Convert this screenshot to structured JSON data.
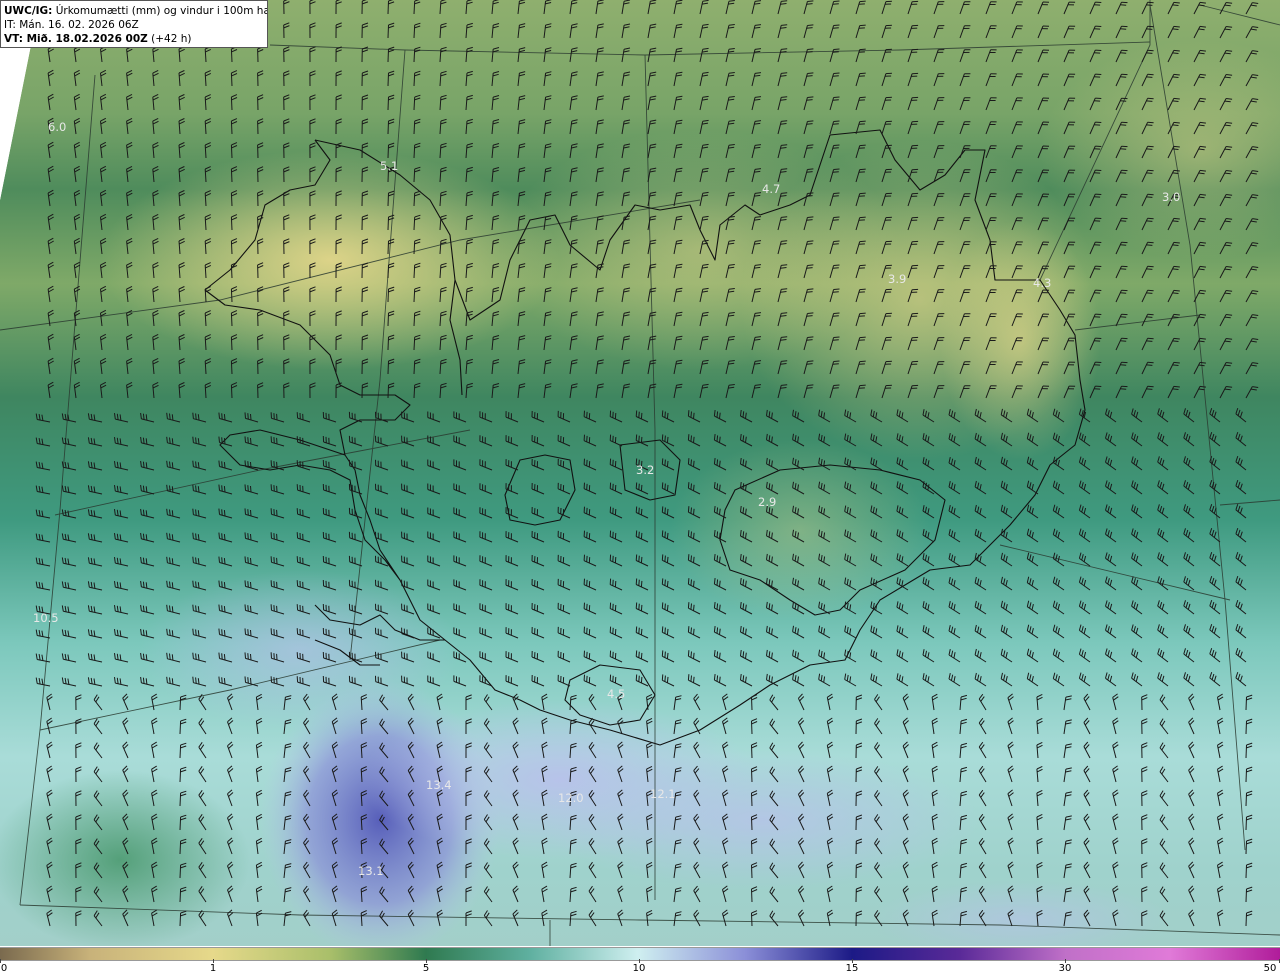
{
  "header": {
    "model_prefix": "UWC/IG:",
    "title": "Úrkomumætti (mm) og vindur i 100m hæð",
    "it_line": "IT: Mán. 16. 02. 2026 06Z",
    "vt_prefix": "VT: Mið. 18.02.2026 00Z",
    "vt_suffix": "(+42 h)"
  },
  "value_labels": [
    "6.0",
    "5.1",
    "4.7",
    "3.0",
    "4.3",
    "3.9",
    "3.2",
    "2.9",
    "10.5",
    "4.5",
    "13.4",
    "12.0",
    "12.1",
    "13.1"
  ],
  "colorbar": {
    "ticks": [
      "0",
      "1",
      "5",
      "10",
      "15",
      "30",
      "50"
    ]
  },
  "colors": {
    "dry": "#e6d98a",
    "mid": "#2f7a50",
    "wet": "#8b8fd8",
    "heavy": "#1c1a86",
    "extreme": "#b01c9a"
  }
}
